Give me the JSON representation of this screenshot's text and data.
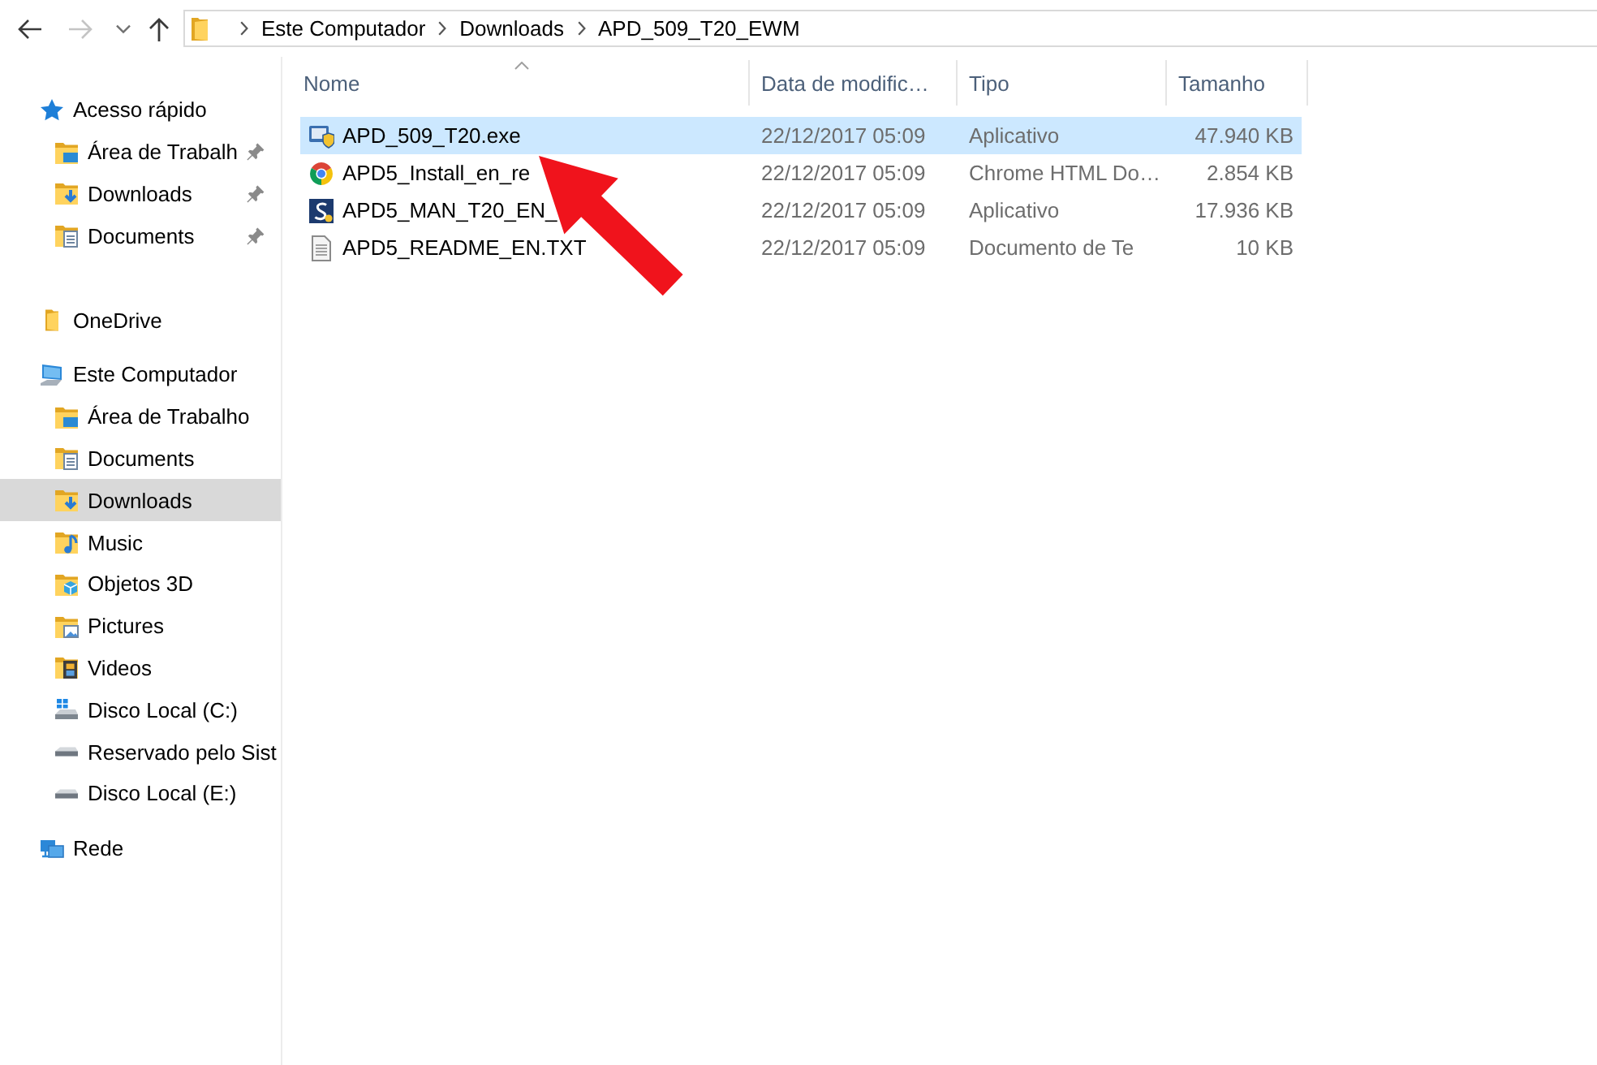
{
  "nav_buttons": [
    {
      "kind": "back",
      "disabled": false
    },
    {
      "kind": "forward",
      "disabled": true
    },
    {
      "kind": "recent",
      "disabled": false
    },
    {
      "kind": "up",
      "disabled": false
    }
  ],
  "address_bar": {
    "path": [
      "Este Computador",
      "Downloads",
      "APD_509_T20_EWM"
    ]
  },
  "sidebar": {
    "groups": [
      {
        "label": "Acesso rápido",
        "kind": "star",
        "selected": false,
        "children": [
          {
            "label": "Área de Trabalh",
            "kind": "desktop",
            "pinned": true,
            "selected": false
          },
          {
            "label": "Downloads",
            "kind": "downloads",
            "pinned": true,
            "selected": false
          },
          {
            "label": "Documents",
            "kind": "documents",
            "pinned": true,
            "selected": false
          }
        ]
      },
      {
        "label": "OneDrive",
        "kind": "folder",
        "selected": false
      },
      {
        "label": "Este Computador",
        "kind": "computer",
        "selected": false,
        "children": [
          {
            "label": "Área de Trabalho",
            "kind": "desktop",
            "selected": false
          },
          {
            "label": "Documents",
            "kind": "documents",
            "selected": false
          },
          {
            "label": "Downloads",
            "kind": "downloads",
            "selected": true
          },
          {
            "label": "Music",
            "kind": "music",
            "selected": false
          },
          {
            "label": "Objetos 3D",
            "kind": "objects3d",
            "selected": false
          },
          {
            "label": "Pictures",
            "kind": "pictures",
            "selected": false
          },
          {
            "label": "Videos",
            "kind": "videos",
            "selected": false
          },
          {
            "label": "Disco Local (C:)",
            "kind": "system_drive",
            "selected": false
          },
          {
            "label": "Reservado pelo Sist",
            "kind": "drive",
            "selected": false
          },
          {
            "label": "Disco Local (E:)",
            "kind": "drive",
            "selected": false
          }
        ]
      },
      {
        "label": "Rede",
        "kind": "network",
        "selected": false
      }
    ]
  },
  "file_list": {
    "columns": [
      {
        "label": "Nome",
        "sorted": true
      },
      {
        "label": "Data de modific…",
        "sorted": false
      },
      {
        "label": "Tipo",
        "sorted": false
      },
      {
        "label": "Tamanho",
        "sorted": false
      }
    ],
    "rows": [
      {
        "name": "APD_509_T20.exe",
        "kind": "installer",
        "modified": "22/12/2017 05:09",
        "type": "Aplicativo",
        "size": "47.940 KB",
        "selected": true
      },
      {
        "name": "APD5_Install_en_re",
        "kind": "web_page",
        "modified": "22/12/2017 05:09",
        "type": "Chrome HTML Do…",
        "size": "2.854 KB",
        "selected": false
      },
      {
        "name": "APD5_MAN_T20_EN_",
        "kind": "application",
        "modified": "22/12/2017 05:09",
        "type": "Aplicativo",
        "size": "17.936 KB",
        "selected": false
      },
      {
        "name": "APD5_README_EN.TXT",
        "kind": "text",
        "modified": "22/12/2017 05:09",
        "type": "Documento de Te",
        "size": "10 KB",
        "selected": false
      }
    ]
  },
  "annotation": {
    "kind": "arrow"
  }
}
